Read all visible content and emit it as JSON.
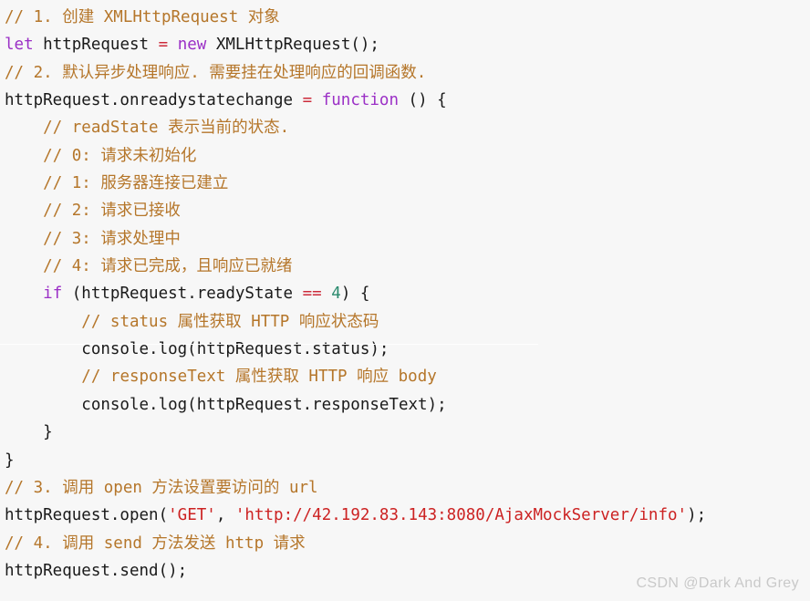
{
  "editor": {
    "language": "javascript",
    "background_color": "#f7f7f7",
    "colors": {
      "comment": "#b5762a",
      "keyword": "#9b30c6",
      "identifier": "#3c50c8",
      "plain": "#1a1a1a",
      "operator": "#cc2a3a",
      "number": "#2a8a6e",
      "string": "#cc2222",
      "divider": "#ffffff"
    },
    "lines": [
      {
        "index": 1,
        "text": "// 1. 创建 XMLHttpRequest 对象",
        "tokens": [
          {
            "t": "// 1. 创建 XMLHttpRequest 对象",
            "c": "comment"
          }
        ]
      },
      {
        "index": 2,
        "text": "let httpRequest = new XMLHttpRequest();",
        "tokens": [
          {
            "t": "let",
            "c": "keyword"
          },
          {
            "t": " ",
            "c": "plain"
          },
          {
            "t": "httpRequest",
            "c": "identifier"
          },
          {
            "t": " ",
            "c": "plain"
          },
          {
            "t": "=",
            "c": "operator"
          },
          {
            "t": " ",
            "c": "plain"
          },
          {
            "t": "new",
            "c": "keyword"
          },
          {
            "t": " ",
            "c": "plain"
          },
          {
            "t": "XMLHttpRequest();",
            "c": "plain"
          }
        ]
      },
      {
        "index": 3,
        "text": "// 2. 默认异步处理响应. 需要挂在处理响应的回调函数.",
        "tokens": [
          {
            "t": "// 2. 默认异步处理响应. 需要挂在处理响应的回调函数.",
            "c": "comment"
          }
        ]
      },
      {
        "index": 4,
        "text": "httpRequest.onreadystatechange = function () {",
        "tokens": [
          {
            "t": "httpRequest.onreadystatechange",
            "c": "plain"
          },
          {
            "t": " ",
            "c": "plain"
          },
          {
            "t": "=",
            "c": "operator"
          },
          {
            "t": " ",
            "c": "plain"
          },
          {
            "t": "function",
            "c": "keyword"
          },
          {
            "t": " () {",
            "c": "plain"
          }
        ]
      },
      {
        "index": 5,
        "text": "    // readState 表示当前的状态.",
        "tokens": [
          {
            "t": "    ",
            "c": "plain"
          },
          {
            "t": "// readState 表示当前的状态.",
            "c": "comment"
          }
        ]
      },
      {
        "index": 6,
        "text": "    // 0: 请求未初始化",
        "tokens": [
          {
            "t": "    ",
            "c": "plain"
          },
          {
            "t": "// 0: 请求未初始化",
            "c": "comment"
          }
        ]
      },
      {
        "index": 7,
        "text": "    // 1: 服务器连接已建立",
        "tokens": [
          {
            "t": "    ",
            "c": "plain"
          },
          {
            "t": "// 1: 服务器连接已建立",
            "c": "comment"
          }
        ]
      },
      {
        "index": 8,
        "text": "    // 2: 请求已接收",
        "tokens": [
          {
            "t": "    ",
            "c": "plain"
          },
          {
            "t": "// 2: 请求已接收",
            "c": "comment"
          }
        ]
      },
      {
        "index": 9,
        "text": "    // 3: 请求处理中",
        "tokens": [
          {
            "t": "    ",
            "c": "plain"
          },
          {
            "t": "// 3: 请求处理中",
            "c": "comment"
          }
        ]
      },
      {
        "index": 10,
        "text": "    // 4: 请求已完成，且响应已就绪",
        "tokens": [
          {
            "t": "    ",
            "c": "plain"
          },
          {
            "t": "// 4: 请求已完成，且响应已就绪",
            "c": "comment"
          }
        ]
      },
      {
        "index": 11,
        "text": "    if (httpRequest.readyState == 4) {",
        "tokens": [
          {
            "t": "    ",
            "c": "plain"
          },
          {
            "t": "if",
            "c": "keyword"
          },
          {
            "t": " (httpRequest.readyState ",
            "c": "plain"
          },
          {
            "t": "==",
            "c": "operator"
          },
          {
            "t": " ",
            "c": "plain"
          },
          {
            "t": "4",
            "c": "number"
          },
          {
            "t": ") {",
            "c": "plain"
          }
        ]
      },
      {
        "index": 12,
        "text": "        // status 属性获取 HTTP 响应状态码",
        "tokens": [
          {
            "t": "        ",
            "c": "plain"
          },
          {
            "t": "// status 属性获取 HTTP 响应状态码",
            "c": "comment"
          }
        ]
      },
      {
        "index": 13,
        "text": "        console.log(httpRequest.status);",
        "tokens": [
          {
            "t": "        console.log(httpRequest.status);",
            "c": "plain"
          }
        ]
      },
      {
        "index": 14,
        "text": "        // responseText 属性获取 HTTP 响应 body",
        "tokens": [
          {
            "t": "        ",
            "c": "plain"
          },
          {
            "t": "// responseText 属性获取 HTTP 响应 body",
            "c": "comment"
          }
        ]
      },
      {
        "index": 15,
        "text": "        console.log(httpRequest.responseText);",
        "tokens": [
          {
            "t": "        console.log(httpRequest.responseText);",
            "c": "plain"
          }
        ]
      },
      {
        "index": 16,
        "text": "    }",
        "tokens": [
          {
            "t": "    }",
            "c": "plain"
          }
        ]
      },
      {
        "index": 17,
        "text": "}",
        "tokens": [
          {
            "t": "}",
            "c": "plain"
          }
        ]
      },
      {
        "index": 18,
        "text": "// 3. 调用 open 方法设置要访问的 url",
        "tokens": [
          {
            "t": "// 3. 调用 open 方法设置要访问的 url",
            "c": "comment"
          }
        ]
      },
      {
        "index": 19,
        "text": "httpRequest.open('GET', 'http://42.192.83.143:8080/AjaxMockServer/info');",
        "tokens": [
          {
            "t": "httpRequest.open(",
            "c": "plain"
          },
          {
            "t": "'GET'",
            "c": "string"
          },
          {
            "t": ", ",
            "c": "plain"
          },
          {
            "t": "'http://42.192.83.143:8080/AjaxMockServer/info'",
            "c": "string"
          },
          {
            "t": ");",
            "c": "plain"
          }
        ]
      },
      {
        "index": 20,
        "text": "// 4. 调用 send 方法发送 http 请求",
        "tokens": [
          {
            "t": "// 4. 调用 send 方法发送 http 请求",
            "c": "comment"
          }
        ]
      },
      {
        "index": 21,
        "text": "httpRequest.send();",
        "tokens": [
          {
            "t": "httpRequest.send();",
            "c": "plain"
          }
        ]
      }
    ]
  },
  "watermark": {
    "text": "CSDN @Dark And Grey",
    "color": "#c9c9c9"
  }
}
